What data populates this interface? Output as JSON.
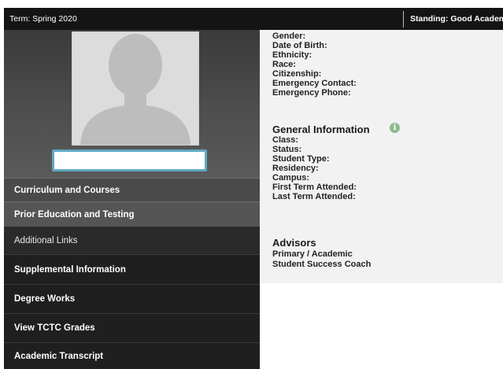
{
  "topbar": {
    "term": "Term: Spring 2020",
    "standing": "Standing: Good Academic Standing"
  },
  "sidebar": {
    "items": [
      {
        "label": "Curriculum and Courses"
      },
      {
        "label": "Prior Education and Testing"
      },
      {
        "label": "Additional Links"
      },
      {
        "label": "Supplemental Information"
      },
      {
        "label": "Degree Works"
      },
      {
        "label": "View TCTC Grades"
      },
      {
        "label": "Academic Transcript"
      }
    ]
  },
  "bio": {
    "fields": [
      "Gender:",
      "Date of Birth:",
      "Ethnicity:",
      "Race:",
      "Citizenship:",
      "Emergency Contact:",
      "Emergency Phone:"
    ]
  },
  "general": {
    "title": "General Information",
    "fields": [
      "Class:",
      "Status:",
      "Student Type:",
      "Residency:",
      "Campus:",
      "First Term Attended:",
      "Last Term Attended:"
    ]
  },
  "advisors": {
    "title": "Advisors",
    "fields": [
      "Primary / Academic",
      "Student Success Coach"
    ]
  },
  "colors": {
    "topbar_bg": "#141414",
    "name_box_border": "#5fa8c4",
    "info_icon": "#8fb98c"
  }
}
